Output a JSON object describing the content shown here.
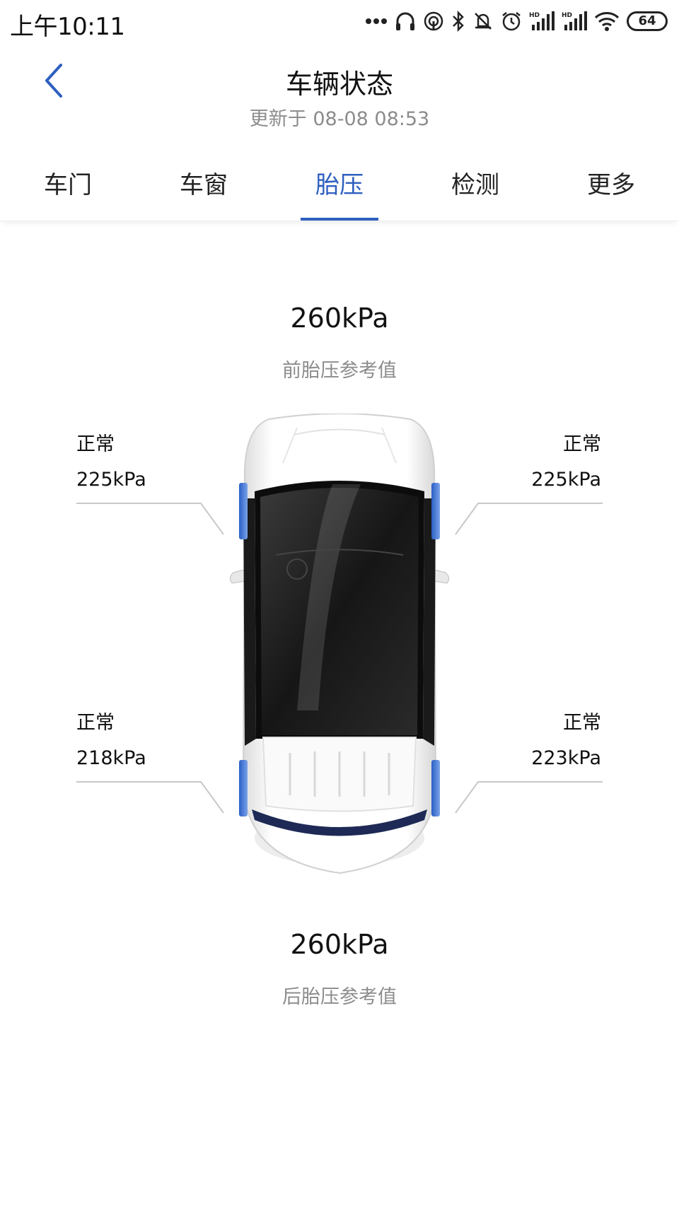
{
  "status_bar": {
    "time": "上午10:11",
    "battery": "64",
    "icons": [
      "more-dots-icon",
      "headphones-icon",
      "hotspot-icon",
      "bluetooth-icon",
      "mute-icon",
      "alarm-icon",
      "signal-hd-icon",
      "signal-hd-icon",
      "wifi-icon",
      "battery-icon"
    ]
  },
  "header": {
    "title": "车辆状态",
    "subtitle": "更新于 08-08 08:53"
  },
  "tabs": [
    {
      "label": "车门",
      "active": false
    },
    {
      "label": "车窗",
      "active": false
    },
    {
      "label": "胎压",
      "active": true
    },
    {
      "label": "检测",
      "active": false
    },
    {
      "label": "更多",
      "active": false
    }
  ],
  "pressure": {
    "front_ref_value": "260kPa",
    "front_ref_label": "前胎压参考值",
    "rear_ref_value": "260kPa",
    "rear_ref_label": "后胎压参考值",
    "front_left": {
      "status": "正常",
      "value": "225kPa"
    },
    "front_right": {
      "status": "正常",
      "value": "225kPa"
    },
    "rear_left": {
      "status": "正常",
      "value": "218kPa"
    },
    "rear_right": {
      "status": "正常",
      "value": "223kPa"
    }
  },
  "colors": {
    "accent": "#2e5fbf",
    "tire_highlight": "#3a6fd0",
    "muted_text": "#8c8c8c"
  }
}
